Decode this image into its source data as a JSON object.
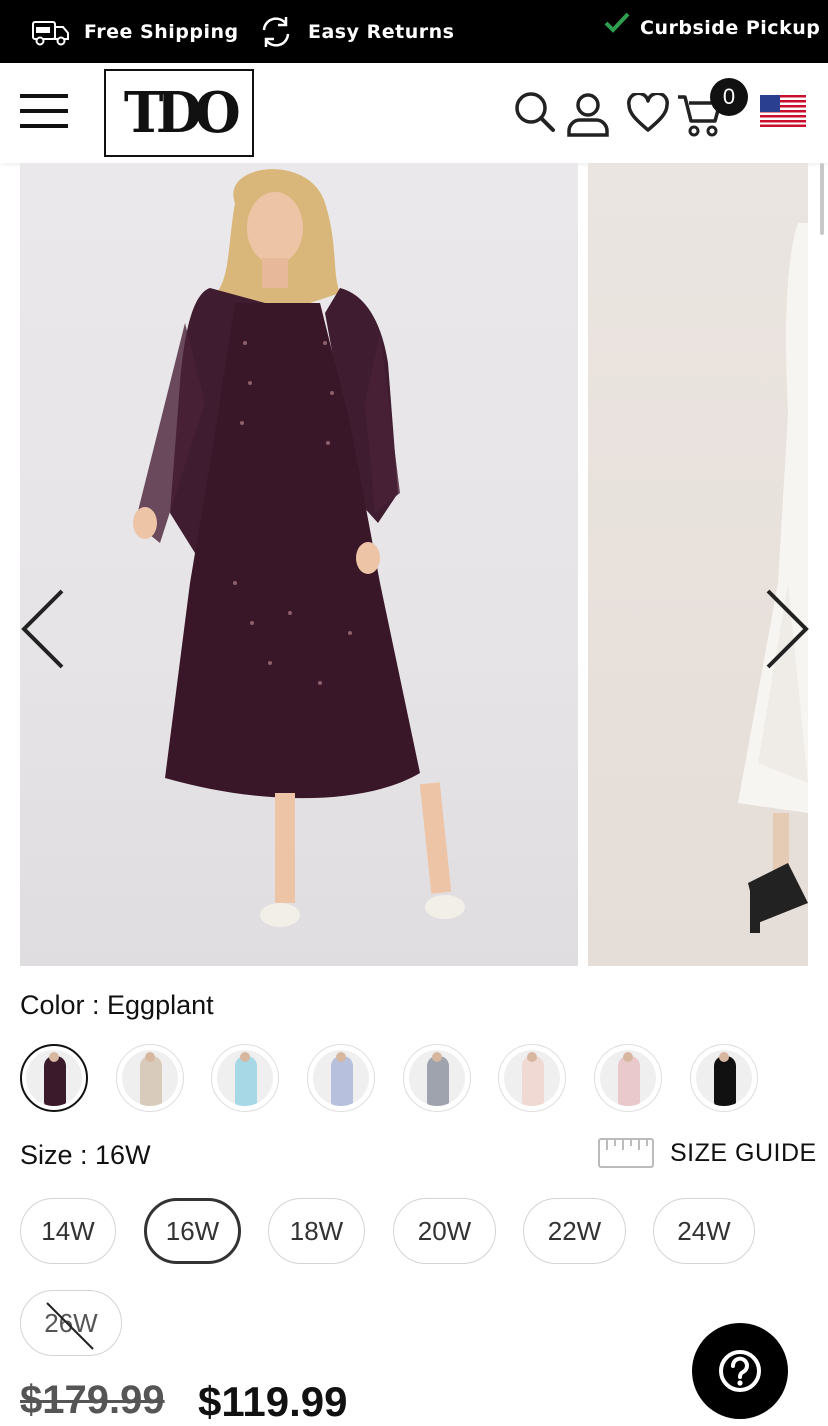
{
  "promo": {
    "free_shipping": "Free Shipping",
    "easy_returns": "Easy Returns",
    "curbside_pickup": "Curbside Pickup",
    "check_color": "#2e9e4f"
  },
  "header": {
    "logo_text": "TDO",
    "cart_count": "0",
    "icons": [
      "menu-icon",
      "search-icon",
      "account-icon",
      "wishlist-heart-icon",
      "cart-icon",
      "us-flag-icon"
    ]
  },
  "gallery": {
    "slides": [
      "eggplant-dress-model-photo",
      "white-dress-model-photo"
    ],
    "prev_icon": "chevron-left-icon",
    "next_icon": "chevron-right-icon"
  },
  "color": {
    "label": "Color : ",
    "value": "Eggplant",
    "swatch_colors": [
      "#3b1a2c",
      "#d9cbbb",
      "#a6d8e6",
      "#b7c0dd",
      "#9ea3ad",
      "#f1d9d3",
      "#e9c9cc",
      "#111111"
    ],
    "selected_index": 0
  },
  "size": {
    "label": "Size : ",
    "value": "16W",
    "guide_label": "SIZE GUIDE",
    "options": [
      "14W",
      "16W",
      "18W",
      "20W",
      "22W",
      "24W",
      "26W"
    ],
    "selected": "16W",
    "unavailable": [
      "26W"
    ]
  },
  "price": {
    "original": "$179.99",
    "sale": "$119.99"
  },
  "help": {
    "icon": "help-question-icon"
  }
}
